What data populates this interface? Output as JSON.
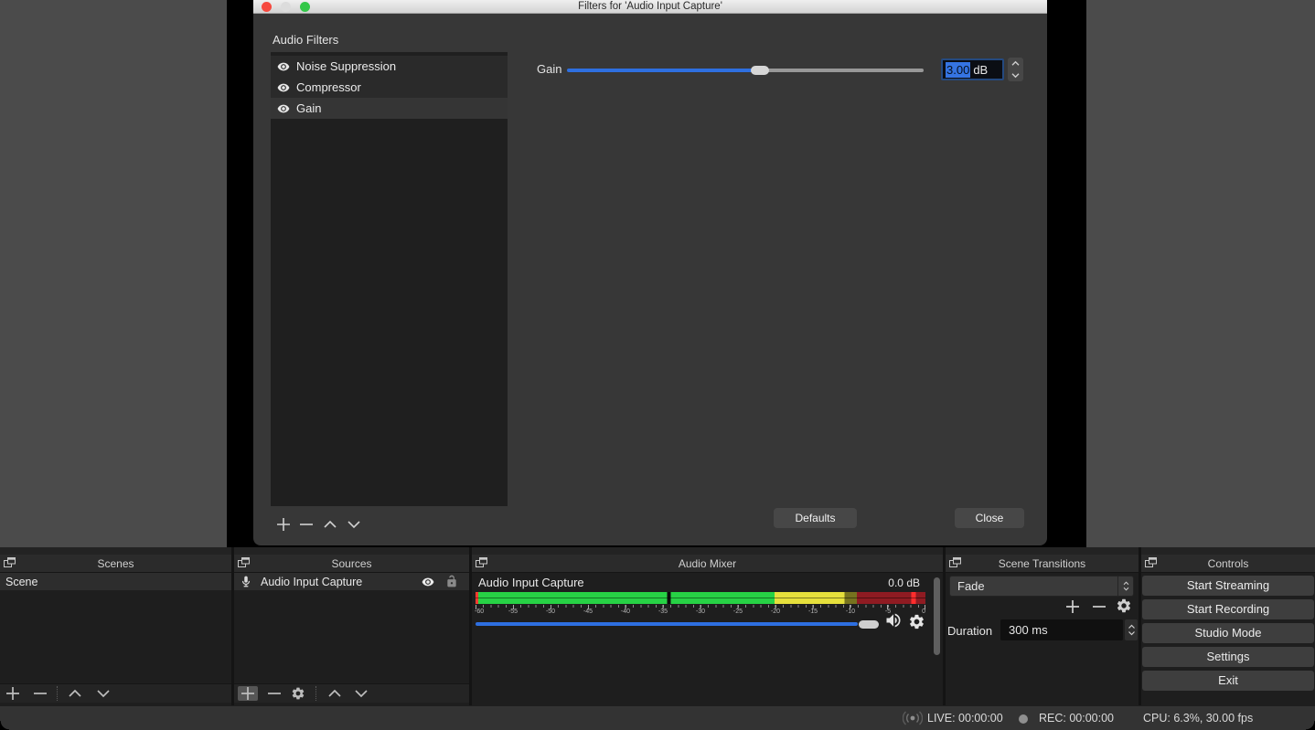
{
  "dialog": {
    "title": "Filters for 'Audio Input Capture'",
    "section_label": "Audio Filters",
    "filters": [
      {
        "name": "Noise Suppression",
        "selected": false
      },
      {
        "name": "Compressor",
        "selected": false
      },
      {
        "name": "Gain",
        "selected": true
      }
    ],
    "gain_label": "Gain",
    "gain_value": "3.00",
    "gain_unit": "dB",
    "gain_slider_percent": 54,
    "defaults_button": "Defaults",
    "close_button": "Close"
  },
  "docks": {
    "scenes": {
      "title": "Scenes",
      "items": [
        {
          "name": "Scene"
        }
      ]
    },
    "sources": {
      "title": "Sources",
      "items": [
        {
          "name": "Audio Input Capture"
        }
      ]
    },
    "audio_mixer": {
      "title": "Audio Mixer",
      "channel": "Audio Input Capture",
      "level": "0.0 dB",
      "meter": {
        "min_db": -60,
        "max_db": 0,
        "level_db": -34.3,
        "green_to_db": -20,
        "yellow_to_db": -10.5,
        "peak_mark_db": -1.5
      },
      "ticks": [
        "-60",
        "-55",
        "-50",
        "-45",
        "-40",
        "-35",
        "-30",
        "-25",
        "-20",
        "-15",
        "-10",
        "-5",
        "0"
      ],
      "volume_percent": 95
    },
    "transitions": {
      "title": "Scene Transitions",
      "selected_transition": "Fade",
      "duration_label": "Duration",
      "duration_value": "300 ms"
    },
    "controls": {
      "title": "Controls",
      "buttons": [
        {
          "label": "Start Streaming"
        },
        {
          "label": "Start Recording"
        },
        {
          "label": "Studio Mode"
        },
        {
          "label": "Settings"
        },
        {
          "label": "Exit"
        }
      ]
    }
  },
  "status_bar": {
    "live": "LIVE: 00:00:00",
    "rec": "REC: 00:00:00",
    "cpu": "CPU: 6.3%, 30.00 fps"
  },
  "colors": {
    "accent_blue": "#2e6fe0",
    "meter_green": "#27d245",
    "meter_yellow": "#e6e03c",
    "meter_red": "#8f1b22",
    "traffic_red": "#f6493f",
    "traffic_green": "#33c748"
  }
}
